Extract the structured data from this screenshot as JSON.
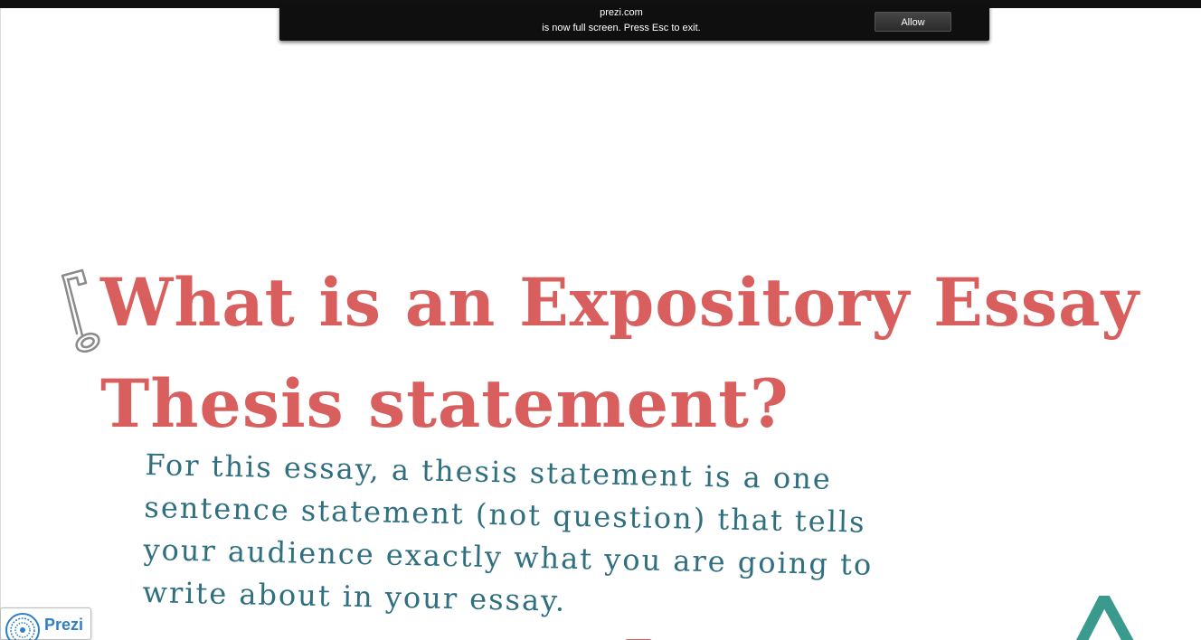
{
  "fullscreen_notice": {
    "domain": "prezi.com",
    "message": "is now full screen. Press Esc to exit.",
    "allow_label": "Allow"
  },
  "slide": {
    "title_line1": "What is an Expository Essay",
    "title_line2": "Thesis statement?",
    "body": "For this essay, a thesis statement is a one sentence statement (not question) that tells your audience exactly what you are going to write about in your essay.",
    "key_icon": "key-icon"
  },
  "branding": {
    "label": "Prezi",
    "logo_icon": "prezi-logo-icon"
  },
  "colors": {
    "title": "#d85f5d",
    "body": "#2f6f80",
    "teal_shape": "#3b9a8e",
    "prezi_blue": "#2f7fc2",
    "notice_bg": "#0f0f0f"
  }
}
